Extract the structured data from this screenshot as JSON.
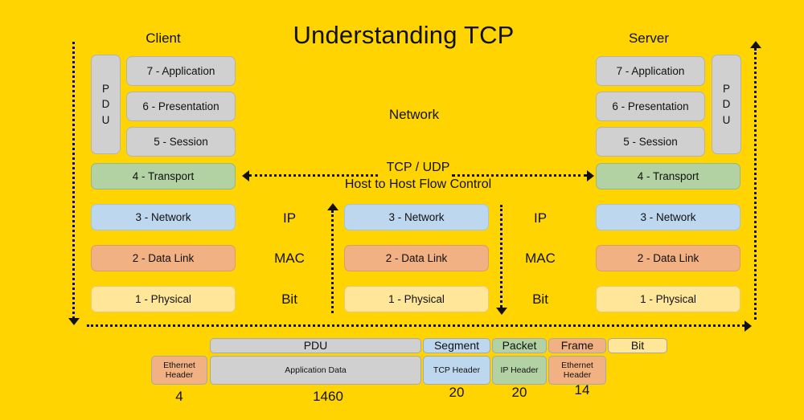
{
  "title": "Understanding TCP",
  "center_label": "Network",
  "colors": {
    "background": "#FFD400",
    "grey": "#D0D0D0",
    "green": "#B2D2A4",
    "blue": "#BDD7EE",
    "salmon": "#F2B183",
    "light_yellow": "#FFE699"
  },
  "client": {
    "heading": "Client",
    "pdu_label": "PDU",
    "pdu_letters": [
      "P",
      "D",
      "U"
    ],
    "layers": [
      {
        "label": "7 - Application",
        "color": "grey"
      },
      {
        "label": "6 - Presentation",
        "color": "grey"
      },
      {
        "label": "5 - Session",
        "color": "grey"
      },
      {
        "label": "4 - Transport",
        "color": "green"
      },
      {
        "label": "3 - Network",
        "color": "blue"
      },
      {
        "label": "2 - Data Link",
        "color": "salmon"
      },
      {
        "label": "1 - Physical",
        "color": "light_yellow"
      }
    ]
  },
  "server": {
    "heading": "Server",
    "pdu_label": "PDU",
    "pdu_letters": [
      "P",
      "D",
      "U"
    ],
    "layers": [
      {
        "label": "7 - Application",
        "color": "grey"
      },
      {
        "label": "6 - Presentation",
        "color": "grey"
      },
      {
        "label": "5 - Session",
        "color": "grey"
      },
      {
        "label": "4 - Transport",
        "color": "green"
      },
      {
        "label": "3 - Network",
        "color": "blue"
      },
      {
        "label": "2 - Data Link",
        "color": "salmon"
      },
      {
        "label": "1 - Physical",
        "color": "light_yellow"
      }
    ]
  },
  "middle_stack": {
    "layers": [
      {
        "label": "3 - Network",
        "color": "blue"
      },
      {
        "label": "2 - Data Link",
        "color": "salmon"
      },
      {
        "label": "1 - Physical",
        "color": "light_yellow"
      }
    ]
  },
  "transport_link": {
    "line1": "TCP / UDP",
    "line2": "Host to Host Flow Control"
  },
  "left_protocols": [
    "IP",
    "MAC",
    "Bit"
  ],
  "right_protocols": [
    "IP",
    "MAC",
    "Bit"
  ],
  "encapsulation": {
    "top_row": [
      {
        "label": "PDU",
        "color": "grey"
      },
      {
        "label": "Segment",
        "color": "blue"
      },
      {
        "label": "Packet",
        "color": "green"
      },
      {
        "label": "Frame",
        "color": "salmon"
      },
      {
        "label": "Bit",
        "color": "light_yellow"
      }
    ],
    "bottom_row": [
      {
        "label": "Ethernet Header",
        "color": "salmon"
      },
      {
        "label": "Application Data",
        "color": "grey"
      },
      {
        "label": "TCP  Header",
        "color": "blue"
      },
      {
        "label": "IP Header",
        "color": "green"
      },
      {
        "label": "Ethernet Header",
        "color": "salmon"
      }
    ],
    "sizes": [
      "4",
      "1460",
      "20",
      "20",
      "14"
    ]
  }
}
